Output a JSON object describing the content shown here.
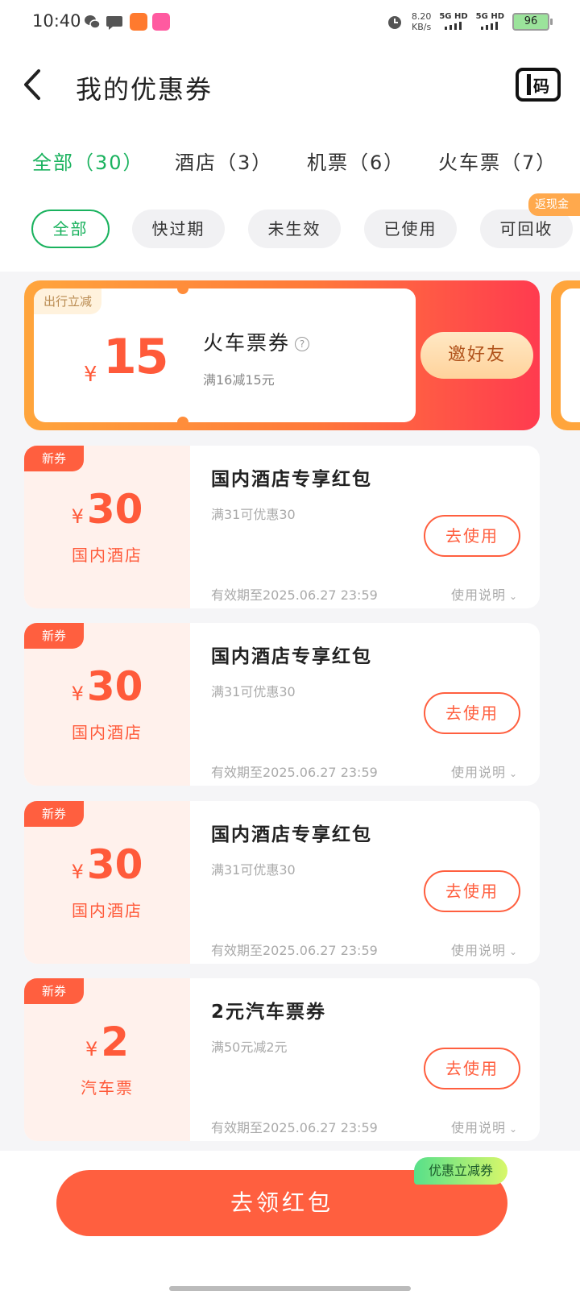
{
  "status_bar": {
    "time": "10:40",
    "speed_value": "8.20",
    "speed_unit": "KB/s",
    "net1": "5G HD",
    "net2": "5G HD",
    "battery": "96",
    "icons": [
      "wechat-icon",
      "message-icon",
      "app-icon",
      "app-icon",
      "alarm-icon",
      "signal-icon",
      "battery-icon"
    ]
  },
  "header": {
    "title": "我的优惠券",
    "code_label": "码"
  },
  "category_tabs": [
    {
      "label": "全部（30）",
      "active": true
    },
    {
      "label": "酒店（3）",
      "active": false
    },
    {
      "label": "机票（6）",
      "active": false
    },
    {
      "label": "火车票（7）",
      "active": false
    }
  ],
  "filters": {
    "chips": [
      {
        "label": "全部",
        "active": true
      },
      {
        "label": "快过期",
        "active": false
      },
      {
        "label": "未生效",
        "active": false
      },
      {
        "label": "已使用",
        "active": false
      },
      {
        "label": "可回收",
        "active": false
      }
    ],
    "badge": "返现金"
  },
  "promo": {
    "tag": "出行立减",
    "currency": "¥",
    "amount": "15",
    "name": "火车票券",
    "condition": "满16减15元",
    "button": "邀好友"
  },
  "coupons": [
    {
      "tag": "新券",
      "currency": "¥",
      "amount": "30",
      "type": "国内酒店",
      "title": "国内酒店专享红包",
      "condition": "满31可优惠30",
      "button": "去使用",
      "expiry": "有效期至2025.06.27 23:59",
      "instructions": "使用说明"
    },
    {
      "tag": "新券",
      "currency": "¥",
      "amount": "30",
      "type": "国内酒店",
      "title": "国内酒店专享红包",
      "condition": "满31可优惠30",
      "button": "去使用",
      "expiry": "有效期至2025.06.27 23:59",
      "instructions": "使用说明"
    },
    {
      "tag": "新券",
      "currency": "¥",
      "amount": "30",
      "type": "国内酒店",
      "title": "国内酒店专享红包",
      "condition": "满31可优惠30",
      "button": "去使用",
      "expiry": "有效期至2025.06.27 23:59",
      "instructions": "使用说明"
    },
    {
      "tag": "新券",
      "currency": "¥",
      "amount": "2",
      "type": "汽车票",
      "title": "2元汽车票券",
      "condition": "满50元减2元",
      "button": "去使用",
      "expiry": "有效期至2025.06.27 23:59",
      "instructions": "使用说明"
    }
  ],
  "bottom": {
    "button": "去领红包",
    "badge": "优惠立减券"
  },
  "colors": {
    "accent_green": "#1ab25e",
    "coupon_red": "#ff5f3f"
  }
}
